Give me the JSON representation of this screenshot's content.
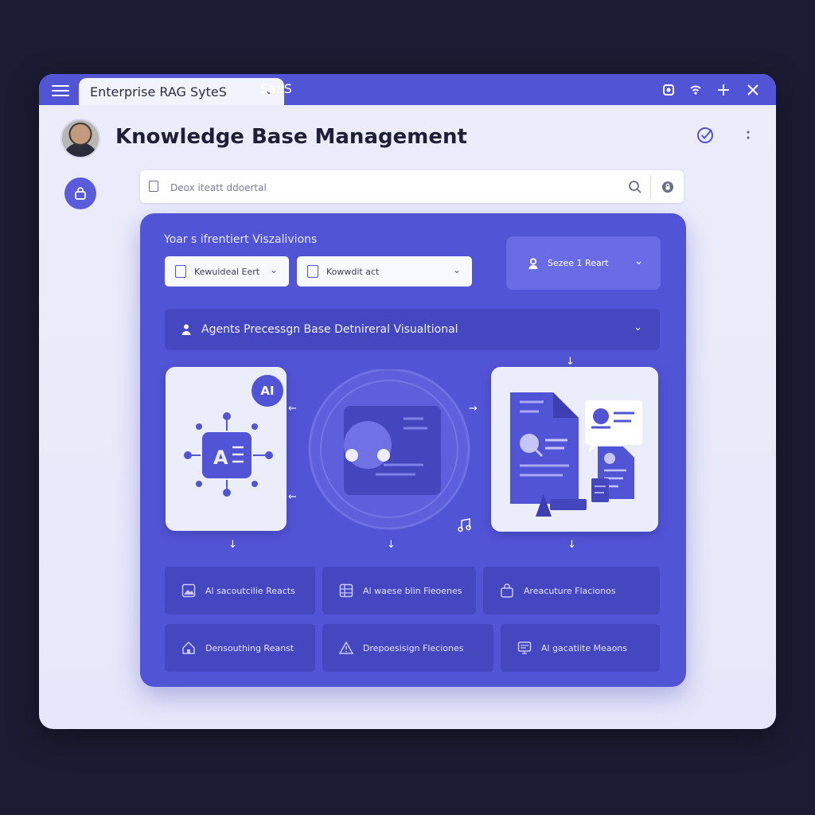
{
  "window": {
    "tabs": [
      {
        "label": "Enterprise RAG SyteS",
        "active": true
      },
      {
        "label": "SaaS",
        "active": false
      }
    ],
    "controls": [
      "camera-icon",
      "wifi-icon",
      "plus-icon",
      "close-icon"
    ]
  },
  "header": {
    "title": "Knowledge Base Management"
  },
  "search": {
    "placeholder": "Deox iteatt ddoertal"
  },
  "panel": {
    "label": "Yoar s ifrentiert Viszalivions",
    "dropdowns": [
      {
        "label": "Kewuideal Eert"
      },
      {
        "label": "Kowwdit act"
      }
    ],
    "select_button": "Sezee 1 Reart",
    "agents_bar": "Agents Precessgn Base Detnireral Visualtional",
    "ai_badge": "AI",
    "results": [
      {
        "label": "Al sacoutcilie Reacts",
        "icon": "image-icon"
      },
      {
        "label": "Al waese blin Fieoenes",
        "icon": "grid-icon"
      },
      {
        "label": "Areacuture Flacionos",
        "icon": "bag-icon"
      },
      {
        "label": "Densouthing Reanst",
        "icon": "home-icon"
      },
      {
        "label": "Drepoesisign Fleciones",
        "icon": "warning-icon"
      },
      {
        "label": "Al gacatiite Meaons",
        "icon": "monitor-icon"
      }
    ]
  },
  "colors": {
    "accent": "#5254d6",
    "panel": "#5254d6",
    "panel_dark": "#4547c0",
    "background": "#1b1c33",
    "window": "#eceefb"
  }
}
